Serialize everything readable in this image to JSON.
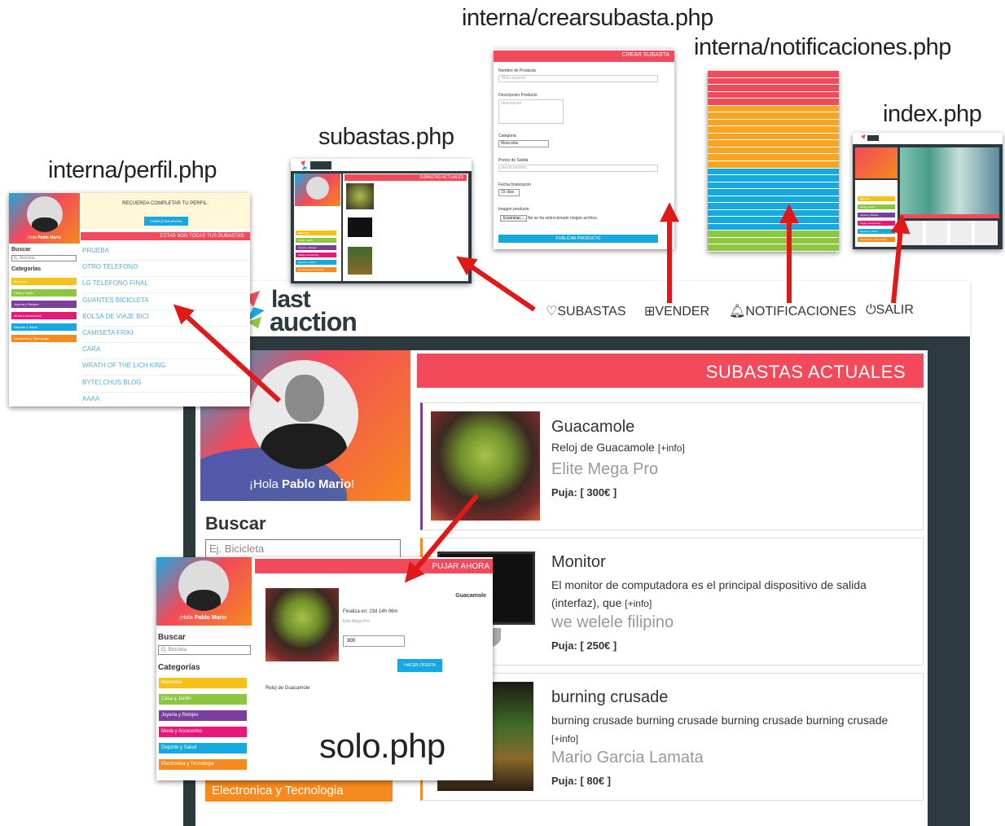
{
  "labels": {
    "crearsubasta": "interna/crearsubasta.php",
    "notificaciones": "interna/notificaciones.php",
    "index": "index.php",
    "subastas": "subastas.php",
    "perfil": "interna/perfil.php",
    "solo": "solo.php"
  },
  "logo": {
    "line1": "last",
    "line2": "auction"
  },
  "nav": {
    "subastas": "SUBASTAS",
    "vender": "VENDER",
    "notificaciones": "NOTIFICACIONES",
    "salir": "SALIR"
  },
  "profile": {
    "greeting_pre": "¡Hola ",
    "greeting_name": "Pablo Mario",
    "greeting_post": "!"
  },
  "search": {
    "title": "Buscar",
    "placeholder": "Ej. Bicicleta"
  },
  "categories_title": "Categorías",
  "categories": [
    "Mascotas",
    "Casa y Jardin",
    "Joyeria y Relojes",
    "Moda y Accesorios",
    "Deporte y Salud",
    "Electronica y Tecnologia"
  ],
  "main": {
    "section_title": "SUBASTAS ACTUALES",
    "info": "[+info]",
    "bid_label": "Puja:",
    "items": [
      {
        "title": "Guacamole",
        "desc": "Reloj de Guacamole",
        "seller": "Elite Mega Pro",
        "bid": "[ 300€ ]"
      },
      {
        "title": "Monitor",
        "desc": "El monitor de computadora es el principal dispositivo de salida (interfaz), que",
        "seller": "we welele filipino",
        "bid": "[ 250€ ]"
      },
      {
        "title": "burning crusade",
        "desc": "burning crusade burning crusade burning crusade burning crusade",
        "seller": "Mario Garcia Lamata",
        "bid": "[ 80€ ]"
      }
    ]
  },
  "perfil": {
    "reminder": "RECUERDA COMPLETAR TU PERFIL:",
    "complete_button": "COMPLETAR AHORA",
    "list_title": "ESTAS SON TODAS TUS SUBASTAS:",
    "auctions": [
      "PRUEBA",
      "OTRO TELEFONO",
      "LG TELEFONO FINAL",
      "GUANTES BICICLETA",
      "BOLSA DE VIAJE BICI",
      "CAMISETA FRIKI",
      "CARA",
      "WRATH OF THE LICH KING",
      "BYTELCHUS BLOG",
      "AAAA"
    ]
  },
  "solo": {
    "header": "PUJAR AHORA",
    "item": "Guacamole",
    "ends": "Finaliza en: 23d 14h 06m",
    "seller": "Elite Mega Pro",
    "amount": "300",
    "bid_button": "HACER OFERTA",
    "desc": "Reloj de Guacamole"
  },
  "crear": {
    "header": "CREAR SUBASTA",
    "name_label": "Nombre de Producto",
    "name_ph": "Titulo anuncio",
    "desc_label": "Descripcion Producto",
    "desc_ph": "descripcion",
    "cat_label": "Categoria",
    "cat_value": "Mascotas",
    "price_label": "Precio de Salida",
    "price_ph": "precio minimo",
    "date_label": "Fecha finalizacion",
    "date_value": "15 dias",
    "image_label": "Imagen producto",
    "file_button": "Examinar...",
    "file_text": "No se ha seleccionado ningún archivo.",
    "publish": "PUBLICAR PRODUCTO"
  },
  "colors": {
    "red": "#f24a5a",
    "orange": "#f68a1e",
    "dark": "#2c3a40",
    "cyan": "#16a9e1",
    "cat": [
      "#f6c218",
      "#8dc63f",
      "#7a3e9d",
      "#e8177a",
      "#16a9e1",
      "#f68a1e"
    ],
    "notif": [
      "#f24a5a",
      "#f24a5a",
      "#f24a5a",
      "#f24a5a",
      "#f24a5a",
      "#f6a623",
      "#f6a623",
      "#f6a623",
      "#f6a623",
      "#f6a623",
      "#f6a623",
      "#f6a623",
      "#f6a623",
      "#f6a623",
      "#16a9e1",
      "#16a9e1",
      "#16a9e1",
      "#16a9e1",
      "#16a9e1",
      "#16a9e1",
      "#16a9e1",
      "#16a9e1",
      "#16a9e1",
      "#8dc63f",
      "#8dc63f",
      "#8dc63f"
    ]
  }
}
